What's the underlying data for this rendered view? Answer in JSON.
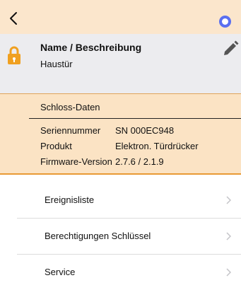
{
  "nav": {
    "back_icon": "chevron-left-icon",
    "status_icon": "ring-icon",
    "status_color": "#5a6ff0"
  },
  "name_section": {
    "lock_icon": "lock-icon",
    "lock_color": "#f0a020",
    "title": "Name / Beschreibung",
    "value": "Haustür",
    "edit_icon": "pencil-icon"
  },
  "lock_data": {
    "title": "Schloss-Daten",
    "rows": [
      {
        "label": "Seriennummer",
        "value": "SN 000EC948"
      },
      {
        "label": "Produkt",
        "value": "Elektron. Türdrücker"
      },
      {
        "label": "Firmware-Version",
        "value": "2.7.6 / 2.1.9"
      }
    ]
  },
  "menu": {
    "items": [
      {
        "label": "Ereignisliste"
      },
      {
        "label": "Berechtigungen Schlüssel"
      },
      {
        "label": "Service"
      }
    ]
  },
  "colors": {
    "header_bg": "#fbe6cc",
    "section_bg": "#ececef",
    "lock_data_bg": "#fbe3c4",
    "accent_orange": "#e89a35"
  }
}
